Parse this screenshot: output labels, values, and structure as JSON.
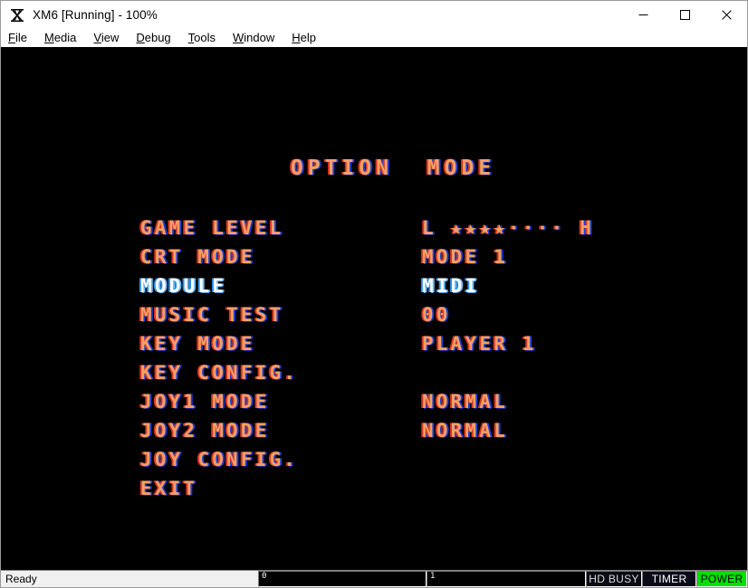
{
  "window": {
    "title": "XM6 [Running] - 100%",
    "icon": "xm6-app-icon",
    "controls": {
      "minimize_label": "–",
      "maximize_label": "□",
      "close_label": "✕"
    }
  },
  "menubar": {
    "items": [
      {
        "accel": "F",
        "rest": "ile"
      },
      {
        "accel": "M",
        "rest": "edia"
      },
      {
        "accel": "V",
        "rest": "iew"
      },
      {
        "accel": "D",
        "rest": "ebug"
      },
      {
        "accel": "T",
        "rest": "ools"
      },
      {
        "accel": "W",
        "rest": "indow"
      },
      {
        "accel": "H",
        "rest": "elp"
      }
    ]
  },
  "screen": {
    "title": "OPTION  MODE",
    "selected_index": 2,
    "rows": [
      {
        "label": "GAME LEVEL",
        "value": "L ★★★★···· H",
        "selected": false
      },
      {
        "label": "CRT MODE",
        "value": "MODE 1",
        "selected": false
      },
      {
        "label": "MODULE",
        "value": "MIDI",
        "selected": true
      },
      {
        "label": "MUSIC TEST",
        "value": "00",
        "selected": false
      },
      {
        "label": "KEY MODE",
        "value": "PLAYER 1",
        "selected": false
      },
      {
        "label": "KEY CONFIG.",
        "value": "",
        "selected": false
      },
      {
        "label": "JOY1 MODE",
        "value": "NORMAL",
        "selected": false
      },
      {
        "label": "JOY2 MODE",
        "value": "NORMAL",
        "selected": false
      },
      {
        "label": "JOY CONFIG.",
        "value": "",
        "selected": false
      },
      {
        "label": "EXIT",
        "value": "",
        "selected": false
      }
    ],
    "game_level": {
      "low_label": "L",
      "high_label": "H",
      "filled": 4,
      "total": 8
    },
    "colors": {
      "background": "#000000",
      "normal_text": "#f4a06a",
      "selected_text": "#ffffff",
      "fringe_red": "#d6341a",
      "fringe_blue": "#1a3fd0"
    }
  },
  "statusbar": {
    "ready_text": "Ready",
    "drive0_label": "0",
    "drive1_label": "1",
    "hd_busy_label": "HD BUSY",
    "timer_label": "TIMER",
    "power_label": "POWER",
    "power_color": "#00e000"
  }
}
